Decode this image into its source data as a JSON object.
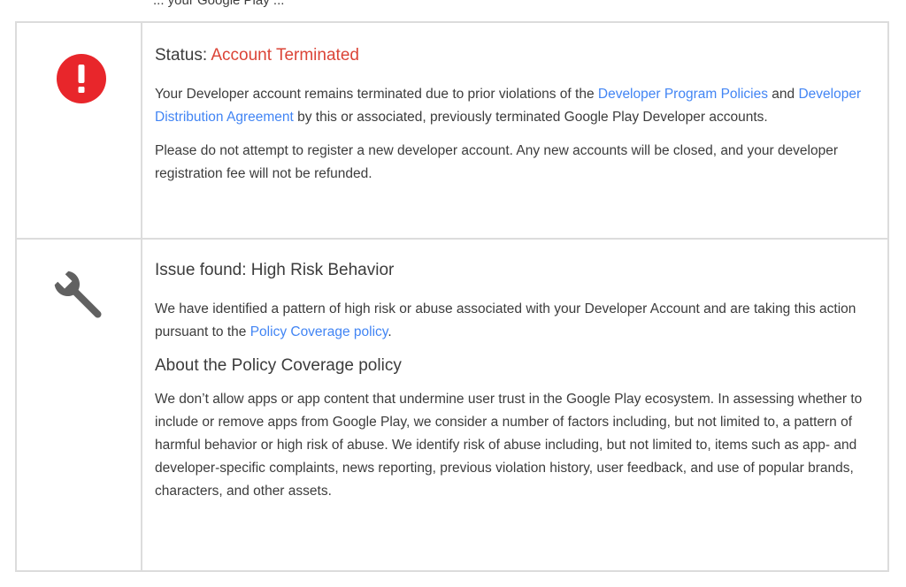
{
  "top_cut_text": "... your Google Play ...",
  "colors": {
    "alert_red": "#e8262b",
    "link_blue": "#4285f4",
    "status_red": "#db4437",
    "wrench_gray": "#616161"
  },
  "status_block": {
    "icon": "alert-circle-icon",
    "status_label": "Status: ",
    "status_value": "Account Terminated",
    "para1_pre": "Your Developer account remains terminated due to prior violations of the ",
    "link_policies": "Developer Program Policies",
    "para1_and": " and ",
    "link_agreement": "Developer Distribution Agreement",
    "para1_post": " by this or associated, previously terminated Google Play Developer accounts.",
    "para2": "Please do not attempt to register a new developer account. Any new accounts will be closed, and your developer registration fee will not be refunded."
  },
  "issue_block": {
    "icon": "wrench-icon",
    "issue_title": "Issue found: High Risk Behavior",
    "para1_pre": "We have identified a pattern of high risk or abuse associated with your Developer Account and are taking this action pursuant to the ",
    "link_policy_coverage": "Policy Coverage policy",
    "para1_post": ".",
    "about_title": "About the Policy Coverage policy",
    "about_para": "We don’t allow apps or app content that undermine user trust in the Google Play ecosystem. In assessing whether to include or remove apps from Google Play, we consider a number of factors including, but not limited to, a pattern of harmful behavior or high risk of abuse. We identify risk of abuse including, but not limited to, items such as app- and developer-specific complaints, news reporting, previous violation history, user feedback, and use of popular brands, characters, and other assets."
  }
}
